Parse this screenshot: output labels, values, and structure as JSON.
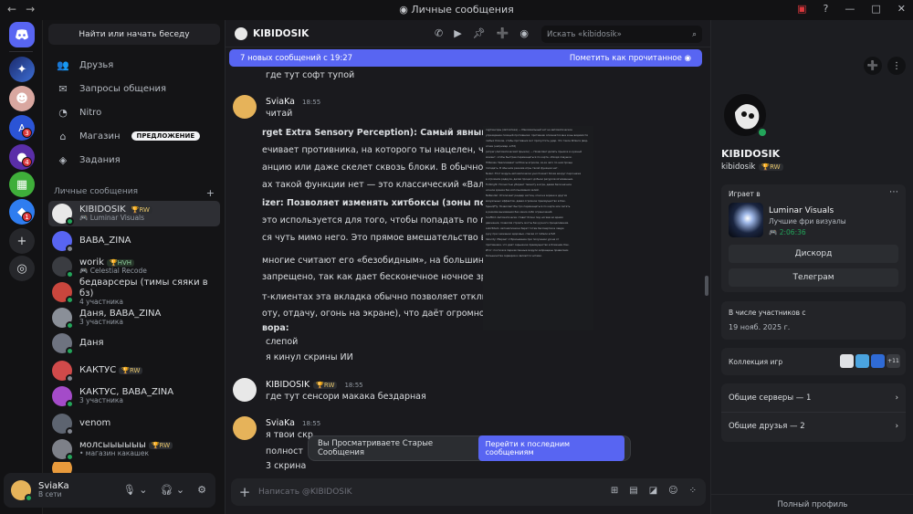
{
  "titlebar": {
    "title": "Личные сообщения",
    "back": "←",
    "forward": "→"
  },
  "guild_badges": [
    "3",
    "4",
    "1"
  ],
  "dm_sidebar": {
    "search": "Найти или начать беседу",
    "nav": [
      {
        "label": "Друзья"
      },
      {
        "label": "Запросы общения"
      },
      {
        "label": "Nitro"
      },
      {
        "label": "Магазин",
        "pill": "ПРЕДЛОЖЕНИЕ"
      },
      {
        "label": "Задания"
      }
    ],
    "header": "Личные сообщения",
    "add": "+",
    "items": [
      {
        "name": "KIBIDOSIK",
        "tag": "🏆RW",
        "sub": "🎮 Luminar Visuals"
      },
      {
        "name": "BABA_ZINA",
        "tag": "",
        "sub": ""
      },
      {
        "name": "worik",
        "tag": "🏆HVH",
        "sub": "🎮 Celestial Recode"
      },
      {
        "name": "бедварсеры (тимы сяяки в бз)",
        "tag": "",
        "sub": "4 участника"
      },
      {
        "name": "Даня, BABA_ZINA",
        "tag": "",
        "sub": "3 участника"
      },
      {
        "name": "Даня",
        "tag": "",
        "sub": ""
      },
      {
        "name": "КАКТУС",
        "tag": "🏆RW",
        "sub": ""
      },
      {
        "name": "КАКТУС, BABA_ZINA",
        "tag": "",
        "sub": "3 участника"
      },
      {
        "name": "venom",
        "tag": "",
        "sub": ""
      },
      {
        "name": "молсыыыыыы",
        "tag": "🏆RW",
        "sub": "• магазин какашек"
      }
    ]
  },
  "user": {
    "name": "SviaKa",
    "status": "В сети"
  },
  "chat": {
    "name": "KIBIDOSIK",
    "search_placeholder": "Искать «kibidosik»",
    "new_messages": "7 новых сообщений с 19:27",
    "mark_read": "Пометить как прочитанное",
    "lines": {
      "l0": "где тут софт тупой",
      "a1": "SviaKa",
      "t1": "18:55",
      "l1": "читай",
      "b1": "rget Extra Sensory Perception): Самый явный чит в",
      "b2": "ечивает противника, на которого ты нацелен, част",
      "b3": "анцию или даже скелет сквозь блоки. В обычном M",
      "b4": "ах такой функции нет — это классический «Валлхак",
      "b5": "izer: Позволяет изменять хитбоксы (зоны поражен",
      "b6": "это используется для того, чтобы попадать по прот",
      "b7": "ся чуть мимо него. Это прямое вмешательство в м",
      "b8": " многие считают его «безобидным», на большинст",
      "b9": "запрещено, так как дает бесконечное ночное зрен",
      "b10": "т-клиентах эта вкладка обычно позволяет отключ",
      "b11": "оту, отдачу, огонь на экране), что даёт огромное пр",
      "b12": "вора:",
      "b13": "слепой",
      "b14": "я кинул скрины ИИ",
      "a2": "KIBIDOSIK",
      "tag2": "🏆RW",
      "t2": "18:55",
      "l2": "где тут сенсори макака бездарная",
      "a3": "SviaKa",
      "t3": "18:55",
      "l3": "я твои скр",
      "l4": "полност",
      "l5": "3 скрина"
    },
    "shot_text": [
      "ing/Сенсоры (Автоатака) — Максимальный чит на автоматическое",
      "упреждение позиций противника: противник опознается вне зоны видимости",
      "любых блоков, чтобы противник мог пропустить удар. Что такое Killaura (вид-",
      "атаки (например, в Hit)",
      "Jumper (Автоматический прыжок) — Позволяет делать прыжок в нужный",
      "момент, чтобы быстрее перемещаться по карте, обходя ловушки.",
      "Hitboxes: Увеличивает хитбоксы игроков, из-за чего по ним проще",
      "попадать. В обычном режиме игры такой функции нет.",
      "Nuker: Этот модуль автоматически уничтожает блоки вокруг персонажа",
      "в огромном радиусе, делая процесс добычи ресурсов мгновенным.",
      "Fullbright: Полностью убирает темноту в игре, давая бесконечное",
      "ночное зрение без использования зелий.",
      "NoRender: Отключает рендер частиц, огня на экране и других",
      "визуальных эффектов, давая огромное преимущество в бою.",
      "Speed/Fly: Позволяет быстро перемещаться по карте или летать",
      "в режиме выживания без каких-либо ограничений.",
      "Scaffold: Автоматически ставит блоки под ногами во время",
      "движения, позволяя строить мосты без ручного прицеливания.",
      "AutoTotem: Автоматически берет тотем бессмертия в левую",
      "руку при снижении здоровья, спасая от гибели в PvP.",
      "Velocity: Убирает отбрасывание при получении урона от",
      "противника, что дает серьезное преимущество в ближнем бою.",
      "Итог: почти все перечисленные модули запрещены правилами",
      "большинства серверов и являются читами."
    ],
    "old_banner": "Вы Просматриваете Старые Сообщения",
    "jump": "Перейти к последним сообщениям",
    "composer": "Написать @KIBIDOSIK"
  },
  "profile": {
    "name": "KIBIDOSIK",
    "username": "kibidosik",
    "tag": "🏆RW",
    "playing_label": "Играет в",
    "game": "Luminar Visuals",
    "game_sub": "Лучшие фри визуалы",
    "elapsed": "2:06:36",
    "btn1": "Дискорд",
    "btn2": "Телеграм",
    "member_label": "В числе участников с",
    "member_date": "19 нояб. 2025 г.",
    "collection": "Коллекция игр",
    "more_games": "+11",
    "servers": "Общие серверы — 1",
    "friends": "Общие друзья — 2",
    "full": "Полный профиль"
  }
}
